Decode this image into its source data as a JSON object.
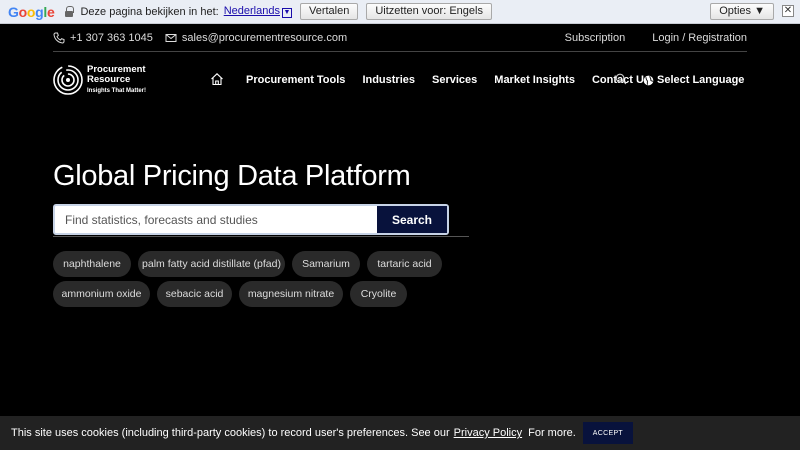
{
  "translate_bar": {
    "logo": [
      "G",
      "o",
      "o",
      "g",
      "l",
      "e"
    ],
    "prompt": "Deze pagina bekijken in het:",
    "language": "Nederlands",
    "translate_button": "Vertalen",
    "off_button": "Uitzetten voor: Engels",
    "options_button": "Opties ▼",
    "close": "✕"
  },
  "topbar": {
    "phone": "+1 307 363 1045",
    "email": "sales@procurementresource.com",
    "subscription": "Subscription",
    "login": "Login / Registration"
  },
  "logo": {
    "line1": "Procurement",
    "line2": "Resource",
    "tagline": "Insights That Matter!"
  },
  "nav": {
    "items": [
      "Procurement Tools",
      "Industries",
      "Services",
      "Market Insights",
      "Contact Us"
    ],
    "language": "Select Language"
  },
  "hero": {
    "title": "Global Pricing Data Platform",
    "search_placeholder": "Find statistics, forecasts and studies",
    "search_button": "Search"
  },
  "chips": [
    "naphthalene",
    "palm fatty acid distillate (pfad)",
    "Samarium",
    "tartaric acid",
    "ammonium oxide",
    "sebacic acid",
    "magnesium nitrate",
    "Cryolite"
  ],
  "cookie": {
    "text": "This site uses cookies (including third-party cookies) to record user's preferences. See our",
    "link": "Privacy Policy",
    "tail": "For more.",
    "accept": "ACCEPT"
  },
  "colors": {
    "accent": "#08123c",
    "background": "#000000"
  }
}
